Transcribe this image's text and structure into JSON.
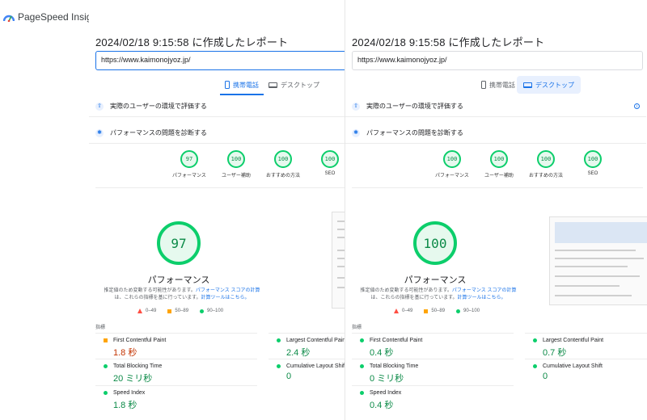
{
  "app": {
    "name": "PageSpeed Insights"
  },
  "colors": {
    "accent": "#1a73e8",
    "pass": "#0cce6b",
    "average": "#ffa400",
    "fail": "#ff4e42"
  },
  "panels": [
    {
      "report_title": "2024/02/18 9:15:58 に作成したレポート",
      "url": "https://www.kaimonojyoz.jp/",
      "tabs": {
        "mobile": "携帯電話",
        "desktop": "デスクトップ",
        "active": "mobile"
      },
      "sections": {
        "field": "実際のユーザーの環境で評価する",
        "lab": "パフォーマンスの問題を診断する"
      },
      "scores": [
        {
          "label": "パフォーマンス",
          "value": "97"
        },
        {
          "label": "ユーザー補助",
          "value": "100"
        },
        {
          "label": "おすすめの方法",
          "value": "100"
        },
        {
          "label": "SEO",
          "value": "100"
        }
      ],
      "main_score": {
        "value": "97",
        "label": "パフォーマンス"
      },
      "desc": {
        "part1": "推定値のため変動する可能性があります。",
        "link1": "パフォーマンス スコアの計算",
        "part2": "は、これらの指標を基に行っています。",
        "link2": "計算ツールはこちら。"
      },
      "legend": {
        "fail": "0–49",
        "average": "50–89",
        "pass": "90–100"
      },
      "metrics_title": "指標",
      "metrics": [
        {
          "name": "First Contentful Paint",
          "value": "1.8 秒",
          "status": "orange"
        },
        {
          "name": "Largest Contentful Paint",
          "value": "2.4 秒",
          "status": "green"
        },
        {
          "name": "Total Blocking Time",
          "value": "20 ミリ秒",
          "status": "green"
        },
        {
          "name": "Cumulative Layout Shift",
          "value": "0",
          "status": "green"
        },
        {
          "name": "Speed Index",
          "value": "1.8 秒",
          "status": "green"
        }
      ]
    },
    {
      "report_title": "2024/02/18 9:15:58 に作成したレポート",
      "url": "https://www.kaimonojyoz.jp/",
      "tabs": {
        "mobile": "携帯電話",
        "desktop": "デスクトップ",
        "active": "desktop"
      },
      "sections": {
        "field": "実際のユーザーの環境で評価する",
        "lab": "パフォーマンスの問題を診断する"
      },
      "scores": [
        {
          "label": "パフォーマンス",
          "value": "100"
        },
        {
          "label": "ユーザー補助",
          "value": "100"
        },
        {
          "label": "おすすめの方法",
          "value": "100"
        },
        {
          "label": "SEO",
          "value": "100"
        }
      ],
      "main_score": {
        "value": "100",
        "label": "パフォーマンス"
      },
      "desc": {
        "part1": "推定値のため変動する可能性があります。",
        "link1": "パフォーマンス スコアの計算",
        "part2": "は、これらの指標を基に行っています。",
        "link2": "計算ツールはこちら。"
      },
      "legend": {
        "fail": "0–49",
        "average": "50–89",
        "pass": "90–100"
      },
      "metrics_title": "指標",
      "metrics": [
        {
          "name": "First Contentful Paint",
          "value": "0.4 秒",
          "status": "green"
        },
        {
          "name": "Largest Contentful Paint",
          "value": "0.7 秒",
          "status": "green"
        },
        {
          "name": "Total Blocking Time",
          "value": "0 ミリ秒",
          "status": "green"
        },
        {
          "name": "Cumulative Layout Shift",
          "value": "0",
          "status": "green"
        },
        {
          "name": "Speed Index",
          "value": "0.4 秒",
          "status": "green"
        }
      ]
    }
  ]
}
